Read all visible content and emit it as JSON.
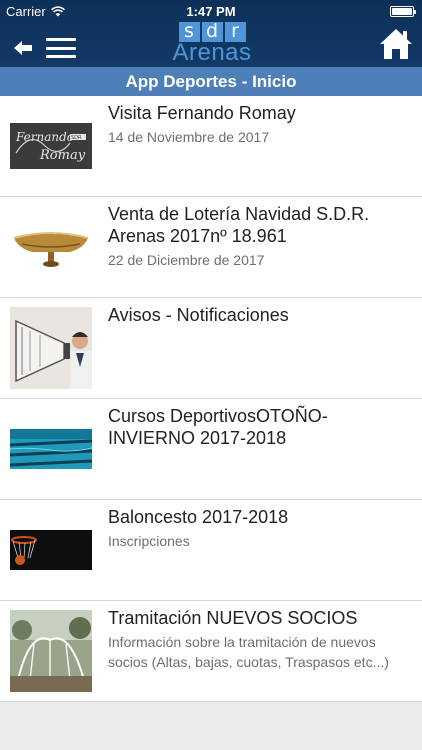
{
  "status": {
    "carrier": "Carrier",
    "time": "1:47 PM"
  },
  "header": {
    "logo_top": [
      "s",
      "d",
      "r"
    ],
    "logo_bottom": "Arenas"
  },
  "section": {
    "title": "App Deportes - Inicio"
  },
  "items": [
    {
      "title": "Visita Fernando Romay",
      "subtitle": "14 de Noviembre de 2017"
    },
    {
      "title": "Venta de Lotería Navidad S.D.R. Arenas 2017nº 18.961",
      "subtitle": "22 de Diciembre de 2017"
    },
    {
      "title": "Avisos - Notificaciones",
      "subtitle": ""
    },
    {
      "title": "Cursos DeportivosOTOÑO-INVIERNO 2017-2018",
      "subtitle": ""
    },
    {
      "title": "Baloncesto 2017-2018",
      "subtitle": "Inscripciones"
    },
    {
      "title": "Tramitación NUEVOS SOCIOS",
      "subtitle": "Información sobre la tramitación de nuevos socios (Altas, bajas, cuotas, Traspasos etc...)"
    }
  ],
  "thumb_labels": {
    "fernando": "Fernando Romay",
    "fernando_brand": "SDR"
  }
}
